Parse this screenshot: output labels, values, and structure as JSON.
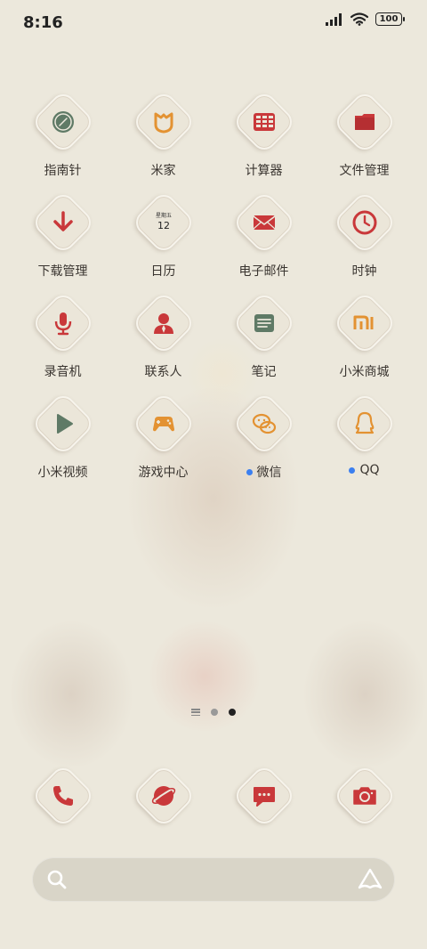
{
  "status": {
    "time": "8:16",
    "battery": "100"
  },
  "apps": [
    {
      "label": "指南针",
      "icon": "compass-icon",
      "color": "#5f7a66"
    },
    {
      "label": "米家",
      "icon": "mijia-icon",
      "color": "#e39232"
    },
    {
      "label": "计算器",
      "icon": "calculator-icon",
      "color": "#c9383a"
    },
    {
      "label": "文件管理",
      "icon": "folder-icon",
      "color": "#c9383a"
    },
    {
      "label": "下载管理",
      "icon": "download-icon",
      "color": "#c9383a"
    },
    {
      "label": "日历",
      "icon": "calendar-icon",
      "color": "#333333",
      "calendar_weekday": "星期五",
      "calendar_day": "12"
    },
    {
      "label": "电子邮件",
      "icon": "mail-icon",
      "color": "#c9383a"
    },
    {
      "label": "时钟",
      "icon": "clock-icon",
      "color": "#c9383a"
    },
    {
      "label": "录音机",
      "icon": "microphone-icon",
      "color": "#c9383a"
    },
    {
      "label": "联系人",
      "icon": "contact-icon",
      "color": "#c9383a"
    },
    {
      "label": "笔记",
      "icon": "notes-icon",
      "color": "#5f7a66"
    },
    {
      "label": "小米商城",
      "icon": "mi-store-icon",
      "color": "#e39232"
    },
    {
      "label": "小米视频",
      "icon": "video-play-icon",
      "color": "#5f7a66"
    },
    {
      "label": "游戏中心",
      "icon": "gamepad-icon",
      "color": "#e39232"
    },
    {
      "label": "微信",
      "icon": "wechat-icon",
      "color": "#e39232",
      "new_dot": true
    },
    {
      "label": "QQ",
      "icon": "qq-penguin-icon",
      "color": "#e39232",
      "new_dot": true
    }
  ],
  "dock": [
    {
      "icon": "phone-icon",
      "color": "#c9383a"
    },
    {
      "icon": "browser-icon",
      "color": "#c9383a"
    },
    {
      "icon": "message-icon",
      "color": "#c9383a"
    },
    {
      "icon": "camera-icon",
      "color": "#c9383a"
    }
  ],
  "pages": {
    "count": 2,
    "active": 2
  },
  "colors": {
    "background": "#ece8dc",
    "accent_red": "#c9383a",
    "accent_orange": "#e39232",
    "accent_green": "#5f7a66",
    "notification_dot": "#3b7ff0"
  }
}
